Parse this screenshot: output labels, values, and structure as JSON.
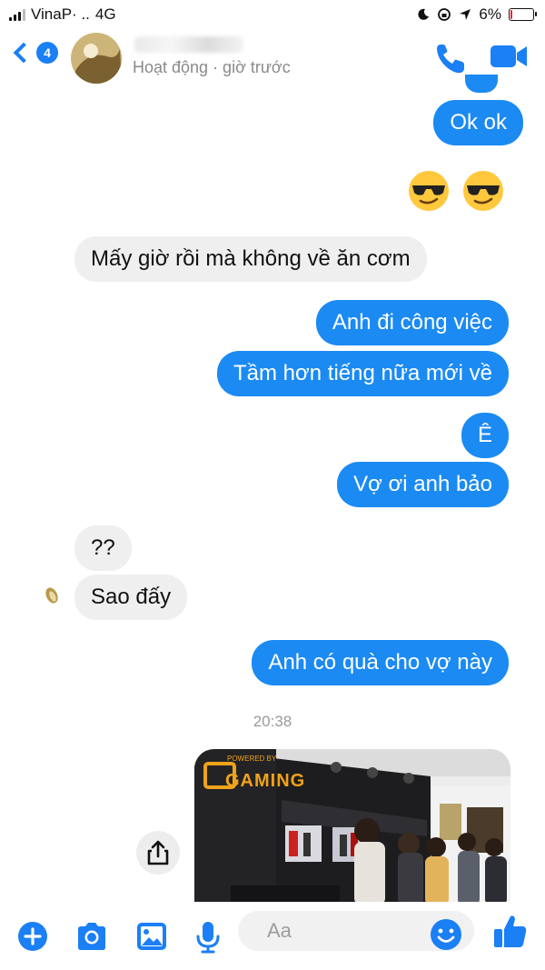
{
  "status_bar": {
    "carrier": "VinaP· ..",
    "network": "4G",
    "battery": "6%",
    "battery_level": 0.06
  },
  "header": {
    "back_count": "4",
    "activity": "Hoạt động · giờ trước"
  },
  "messages": {
    "m1": "Ok ok",
    "m2": "Mấy giờ rồi mà không về ăn cơm",
    "m3": "Anh đi công việc",
    "m4": "Tầm hơn tiếng nữa mới về",
    "m5": "Ê",
    "m6": "Vợ ơi anh bảo",
    "m7": "??",
    "m8": "Sao đấy",
    "m9": "Anh có quà cho vợ này"
  },
  "timestamp": "20:38",
  "photo": {
    "sign_text": "GAMING",
    "subtext": "POWERED BY"
  },
  "composer": {
    "placeholder": "Aa"
  },
  "colors": {
    "accent": "#1b8af3",
    "incoming_bg": "#efefef"
  },
  "icons": {
    "header": [
      "back-chevron-icon",
      "phone-icon",
      "video-camera-icon"
    ],
    "composer": [
      "plus-icon",
      "camera-icon",
      "image-icon",
      "microphone-icon",
      "emoji-icon",
      "thumbs-up-icon"
    ],
    "other": [
      "share-icon",
      "sunglasses-emoji"
    ]
  }
}
